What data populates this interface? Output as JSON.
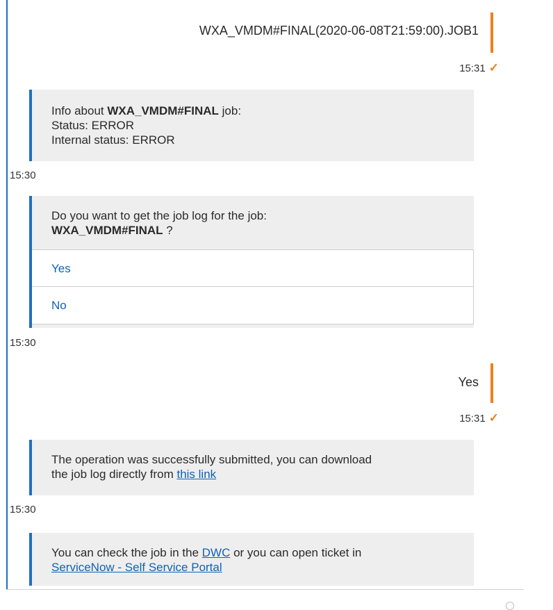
{
  "messages": {
    "user1": {
      "text": "WXA_VMDM#FINAL(2020-06-08T21:59:00).JOB1",
      "time": "15:31"
    },
    "bot1": {
      "prefix": "Info about ",
      "job_name": "WXA_VMDM#FINAL",
      "suffix": " job:",
      "status": "Status: ERROR",
      "internal_status": "Internal status: ERROR",
      "time": "15:30"
    },
    "bot2": {
      "question": "Do you want to get the job log for the job:",
      "job_name": "WXA_VMDM#FINAL",
      "after": " ?",
      "options": [
        "Yes",
        "No"
      ],
      "time": "15:30"
    },
    "user2": {
      "text": "Yes",
      "time": "15:31"
    },
    "bot3": {
      "text_line1": "The operation was successfully submitted, you can download",
      "text_line2": "the job log directly from ",
      "link": "this link",
      "time": "15:30"
    },
    "bot4": {
      "text_before": "You can check the job in the ",
      "link1": "DWC",
      "text_middle": " or you can open ticket in",
      "link2": "ServiceNow - Self Service Portal"
    }
  },
  "colors": {
    "accent_blue": "#1f6fbf",
    "accent_orange": "#f07f1a",
    "card_bg": "#eeeeee",
    "link": "#0f62b5"
  },
  "icons": {
    "delivered": "check-icon"
  }
}
